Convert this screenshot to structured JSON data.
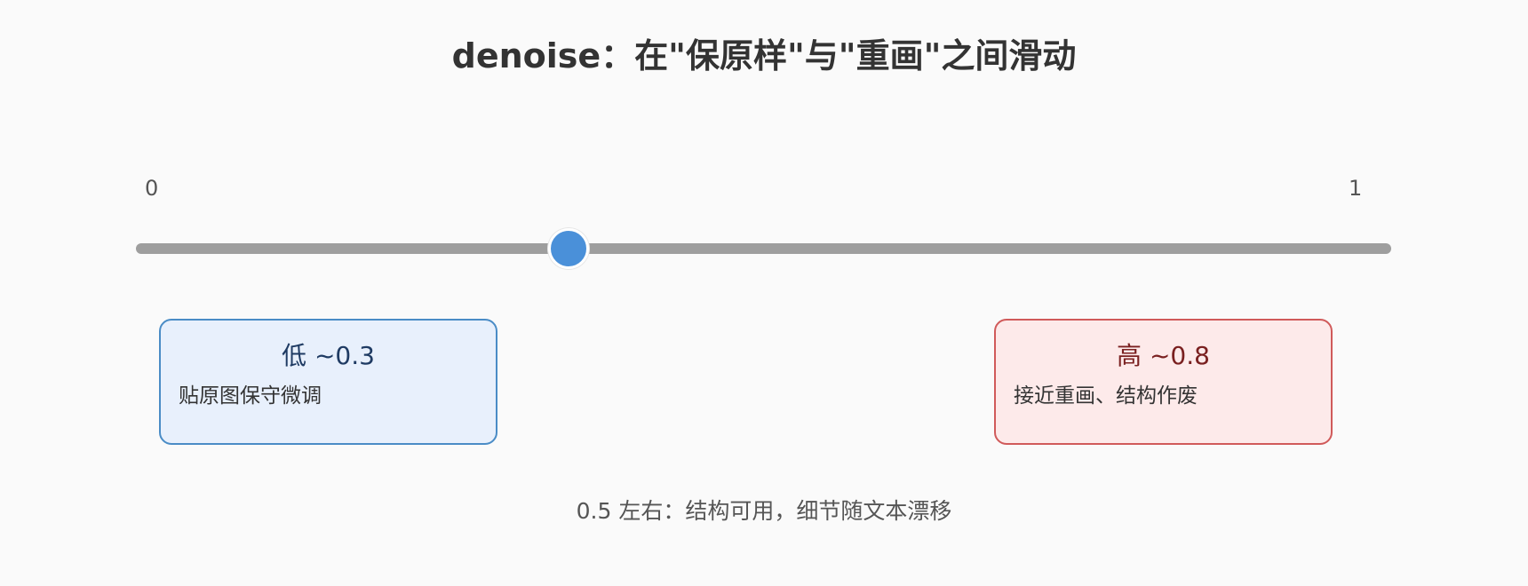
{
  "title": "denoise：在\"保原样\"与\"重画\"之间滑动",
  "slider": {
    "min_label": "0",
    "max_label": "1",
    "min": 0,
    "max": 1,
    "value": 0.345,
    "track_color": "#9e9e9e",
    "thumb_color": "#4a90d9"
  },
  "low_card": {
    "heading": "低 ~0.3",
    "description": "贴原图保守微调",
    "fill_color": "#e8f0fc",
    "border_color": "#4a8cc6"
  },
  "high_card": {
    "heading": "高 ~0.8",
    "description": "接近重画、结构作废",
    "fill_color": "#fdeaea",
    "border_color": "#d05a5a"
  },
  "footnote": "0.5 左右：结构可用，细节随文本漂移"
}
